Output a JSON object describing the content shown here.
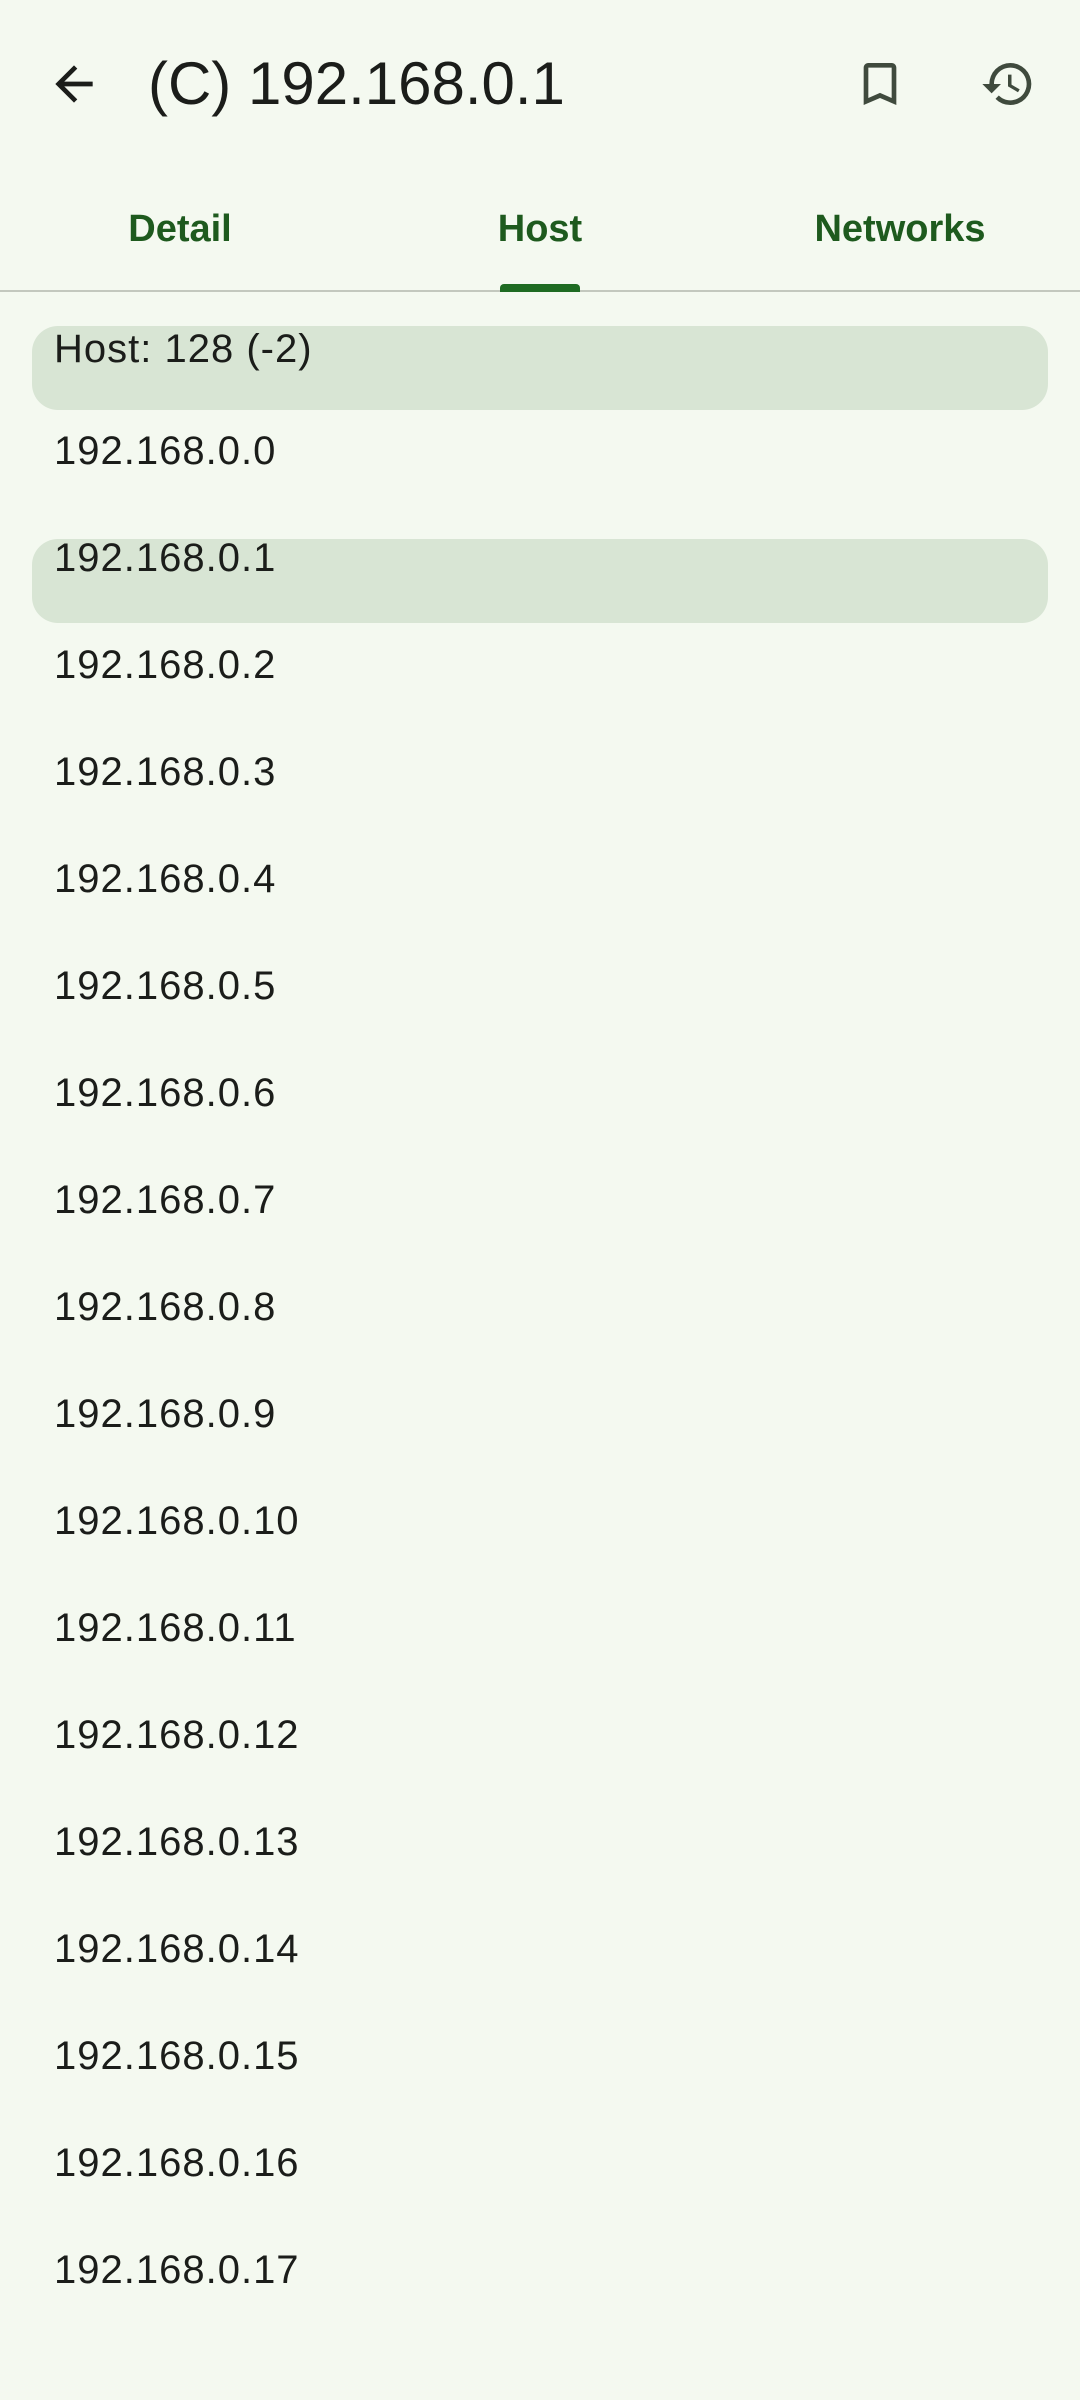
{
  "app_bar": {
    "title": "(C) 192.168.0.1",
    "icons": [
      "arrow-back-icon",
      "bookmark-icon",
      "history-icon"
    ]
  },
  "tabs": [
    {
      "label": "Detail"
    },
    {
      "label": "Host",
      "selected": true
    },
    {
      "label": "Networks"
    }
  ],
  "host_list": {
    "header": "Host: 128 (-2)",
    "items": [
      {
        "address": "192.168.0.0"
      },
      {
        "address": "192.168.0.1",
        "selected": true
      },
      {
        "address": "192.168.0.2"
      },
      {
        "address": "192.168.0.3"
      },
      {
        "address": "192.168.0.4"
      },
      {
        "address": "192.168.0.5"
      },
      {
        "address": "192.168.0.6"
      },
      {
        "address": "192.168.0.7"
      },
      {
        "address": "192.168.0.8"
      },
      {
        "address": "192.168.0.9"
      },
      {
        "address": "192.168.0.10"
      },
      {
        "address": "192.168.0.11"
      },
      {
        "address": "192.168.0.12"
      },
      {
        "address": "192.168.0.13"
      },
      {
        "address": "192.168.0.14"
      },
      {
        "address": "192.168.0.15"
      },
      {
        "address": "192.168.0.16"
      },
      {
        "address": "192.168.0.17"
      }
    ]
  },
  "colors": {
    "background": "#F4F9F0",
    "accent": "#1E6B22",
    "tab_text": "#1E5A1E",
    "highlight": "#D8E5D4",
    "divider": "#C3C8BE"
  }
}
